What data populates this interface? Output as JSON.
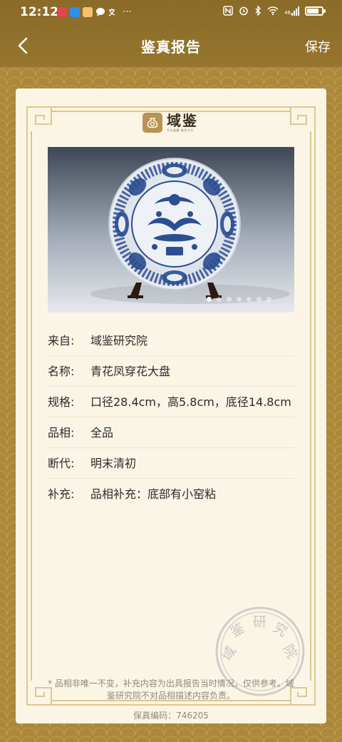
{
  "status_bar": {
    "time": "12:12",
    "extra": "⋯",
    "network": "46",
    "battery_level": 0.8
  },
  "nav": {
    "title": "鉴真报告",
    "save_label": "保存"
  },
  "brand": {
    "name": "域鉴",
    "tagline": "专业鉴藏 服务大众"
  },
  "gallery": {
    "image_count": 7,
    "active_index": 0
  },
  "details": [
    {
      "key": "来自:",
      "value": "域鉴研究院"
    },
    {
      "key": "名称:",
      "value": "青花凤穿花大盘"
    },
    {
      "key": "规格:",
      "value": "口径28.4cm，高5.8cm，底径14.8cm"
    },
    {
      "key": "品相:",
      "value": "全品"
    },
    {
      "key": "断代:",
      "value": "明末清初"
    },
    {
      "key": "补充:",
      "value": "品相补充：底部有小窑粘"
    }
  ],
  "disclaimer": "* 品相非唯一不变，补充内容为出具报告当时情况，仅供参考。域鉴研究院不对品相描述内容负责。",
  "code": {
    "label": "保真编码：",
    "value": "746205"
  },
  "seal": {
    "text": "域鉴研究院"
  },
  "colors": {
    "header": "#8a6b28",
    "background": "#ab883a",
    "card": "#fbf5e6",
    "frame": "#d9c48e"
  }
}
